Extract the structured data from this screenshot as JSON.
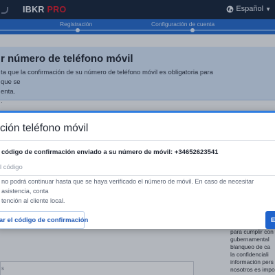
{
  "header": {
    "brand": "IBKR",
    "brand_suffix": "PRO",
    "language": "Español",
    "language_icon": "globe-icon"
  },
  "stepper": {
    "steps": [
      {
        "label": "Registración"
      },
      {
        "label": "Configuración de cuenta"
      }
    ]
  },
  "banner": {
    "title": "r número de teléfono móvil",
    "text": "ta que la confirmación de su número de teléfono móvil es obligatoria para que se\nenta.\n."
  },
  "side_text": "para cumplir con\ngubernamental\nblanqueo de ca\nla confidenciali\ninformación pers\nnosotros es impo",
  "modal": {
    "title": "ción teléfono móvil",
    "code_label": "código de confirmación enviado a su número de móvil: +34652623541",
    "code_input": {
      "value": "",
      "placeholder": "l código"
    },
    "help_text": "no podrá continuar hasta que se haya verificado el número de móvil. En caso de necesitar asistencia, conta\ntención al cliente local.",
    "resend_label": "viar el código de confirmación",
    "primary_label": "E",
    "accent_color": "#2f7de1"
  },
  "footer_box_text": "s"
}
